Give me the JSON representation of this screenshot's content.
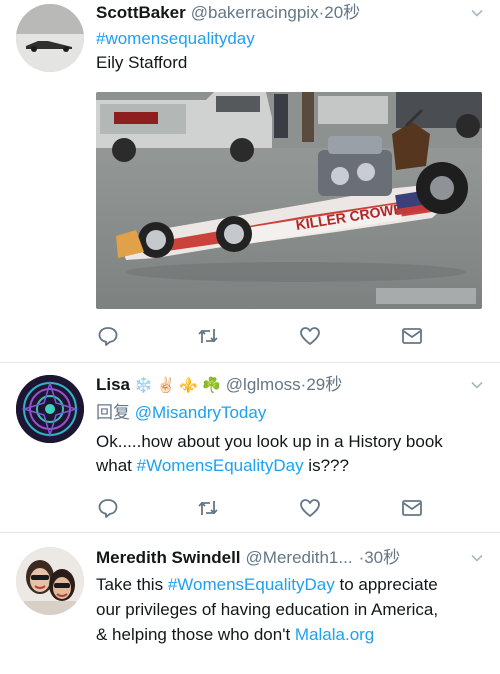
{
  "tweets": [
    {
      "name": "ScottBaker",
      "handle": "@bakerracingpix",
      "time": "·20秒",
      "hashtag": "#womensequalityday",
      "text": "Eily Stafford",
      "image_text": "KILLER CROWER"
    },
    {
      "name": "Lisa",
      "emoji": [
        "❄️",
        "✌🏻",
        "⚜️",
        "☘️"
      ],
      "handle": "@lglmoss",
      "time": "·29秒",
      "reply_prefix": "回复",
      "reply_to": "@MisandryToday",
      "text_before": "Ok.....how about you look up in a History book what ",
      "hashtag": "#WomensEqualityDay",
      "text_after": " is???"
    },
    {
      "name": "Meredith Swindell",
      "handle": "@Meredith1...",
      "time": "·30秒",
      "text_before": "Take this ",
      "hashtag": "#WomensEqualityDay",
      "text_middle": " to appreciate our privileges of having education in America, & helping those who don't ",
      "link": "Malala.org"
    }
  ],
  "colors": {
    "link": "#1da1f2",
    "secondary": "#657786",
    "icon": "#657786",
    "separator": "#e1e8ed"
  },
  "icons": [
    "reply-icon",
    "retweet-icon",
    "like-icon",
    "direct-message-icon",
    "chevron-down-icon"
  ]
}
